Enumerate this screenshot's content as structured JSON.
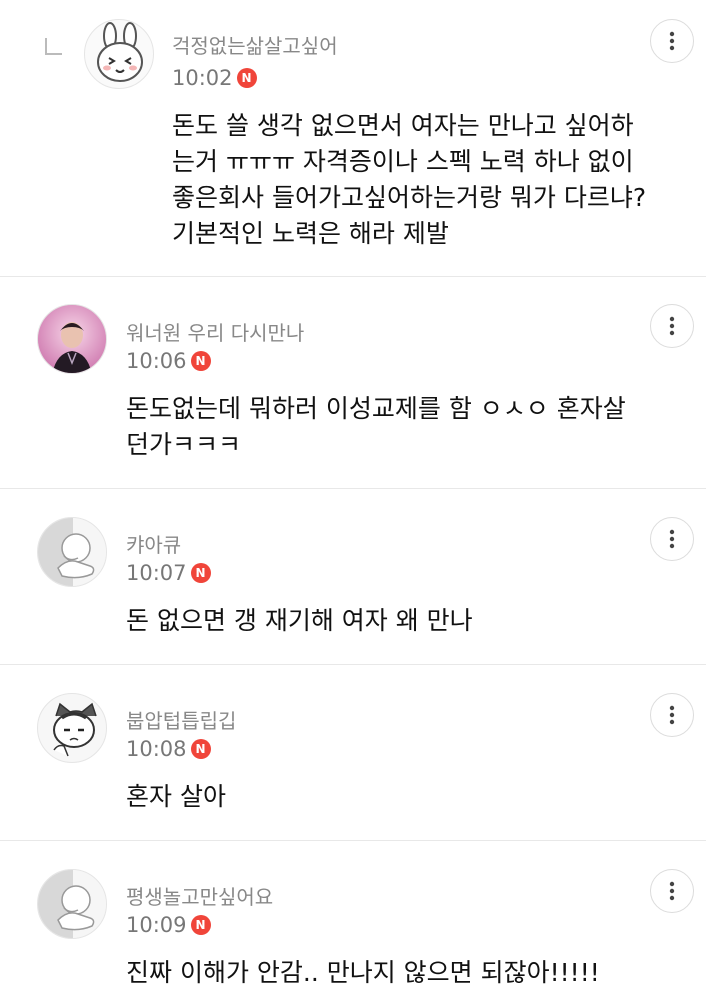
{
  "comments": [
    {
      "author": "걱정없는삶살고싶어",
      "time": "10:02",
      "new_badge": "N",
      "text": "돈도 쓸 생각 없으면서 여자는 만나고 싶어하\n는거 ㅠㅠㅠ 자격증이나 스펙 노력 하나 없이\n좋은회사 들어가고싶어하는거랑 뭐가 다르냐?\n기본적인 노력은 해라 제발",
      "avatar_icon": "rabbit-avatar-icon"
    },
    {
      "author": "워너원 우리 다시만나",
      "time": "10:06",
      "new_badge": "N",
      "text": "돈도없는데 뭐하러 이성교제를 함 ㅇㅅㅇ 혼자살\n던가ㅋㅋㅋ",
      "avatar_icon": "photo-avatar-icon"
    },
    {
      "author": "캬아큐",
      "time": "10:07",
      "new_badge": "N",
      "text": "돈 없으면 갱 재기해 여자 왜 만나",
      "avatar_icon": "default-avatar-icon"
    },
    {
      "author": "붑압텁틉립깁",
      "time": "10:08",
      "new_badge": "N",
      "text": "혼자 살아",
      "avatar_icon": "cat-avatar-icon"
    },
    {
      "author": "평생놀고만싶어요",
      "time": "10:09",
      "new_badge": "N",
      "text": "진짜 이해가 안감.. 만나지 않으면 되잖아!!!!!",
      "avatar_icon": "default-avatar-icon"
    }
  ],
  "colors": {
    "badge": "#f0453a",
    "name": "#888888",
    "divider": "#e8e8e8"
  }
}
